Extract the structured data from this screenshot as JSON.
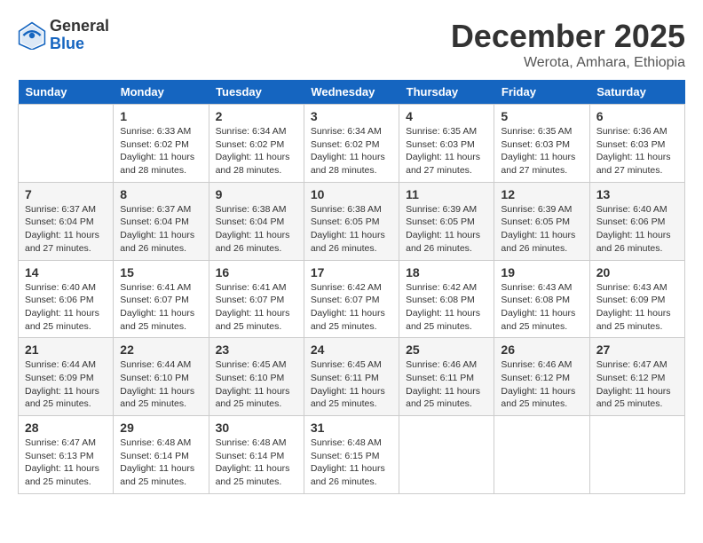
{
  "header": {
    "logo_general": "General",
    "logo_blue": "Blue",
    "month_title": "December 2025",
    "subtitle": "Werota, Amhara, Ethiopia"
  },
  "weekdays": [
    "Sunday",
    "Monday",
    "Tuesday",
    "Wednesday",
    "Thursday",
    "Friday",
    "Saturday"
  ],
  "weeks": [
    [
      {
        "day": "",
        "sunrise": "",
        "sunset": "",
        "daylight": ""
      },
      {
        "day": "1",
        "sunrise": "Sunrise: 6:33 AM",
        "sunset": "Sunset: 6:02 PM",
        "daylight": "Daylight: 11 hours and 28 minutes."
      },
      {
        "day": "2",
        "sunrise": "Sunrise: 6:34 AM",
        "sunset": "Sunset: 6:02 PM",
        "daylight": "Daylight: 11 hours and 28 minutes."
      },
      {
        "day": "3",
        "sunrise": "Sunrise: 6:34 AM",
        "sunset": "Sunset: 6:02 PM",
        "daylight": "Daylight: 11 hours and 28 minutes."
      },
      {
        "day": "4",
        "sunrise": "Sunrise: 6:35 AM",
        "sunset": "Sunset: 6:03 PM",
        "daylight": "Daylight: 11 hours and 27 minutes."
      },
      {
        "day": "5",
        "sunrise": "Sunrise: 6:35 AM",
        "sunset": "Sunset: 6:03 PM",
        "daylight": "Daylight: 11 hours and 27 minutes."
      },
      {
        "day": "6",
        "sunrise": "Sunrise: 6:36 AM",
        "sunset": "Sunset: 6:03 PM",
        "daylight": "Daylight: 11 hours and 27 minutes."
      }
    ],
    [
      {
        "day": "7",
        "sunrise": "Sunrise: 6:37 AM",
        "sunset": "Sunset: 6:04 PM",
        "daylight": "Daylight: 11 hours and 27 minutes."
      },
      {
        "day": "8",
        "sunrise": "Sunrise: 6:37 AM",
        "sunset": "Sunset: 6:04 PM",
        "daylight": "Daylight: 11 hours and 26 minutes."
      },
      {
        "day": "9",
        "sunrise": "Sunrise: 6:38 AM",
        "sunset": "Sunset: 6:04 PM",
        "daylight": "Daylight: 11 hours and 26 minutes."
      },
      {
        "day": "10",
        "sunrise": "Sunrise: 6:38 AM",
        "sunset": "Sunset: 6:05 PM",
        "daylight": "Daylight: 11 hours and 26 minutes."
      },
      {
        "day": "11",
        "sunrise": "Sunrise: 6:39 AM",
        "sunset": "Sunset: 6:05 PM",
        "daylight": "Daylight: 11 hours and 26 minutes."
      },
      {
        "day": "12",
        "sunrise": "Sunrise: 6:39 AM",
        "sunset": "Sunset: 6:05 PM",
        "daylight": "Daylight: 11 hours and 26 minutes."
      },
      {
        "day": "13",
        "sunrise": "Sunrise: 6:40 AM",
        "sunset": "Sunset: 6:06 PM",
        "daylight": "Daylight: 11 hours and 26 minutes."
      }
    ],
    [
      {
        "day": "14",
        "sunrise": "Sunrise: 6:40 AM",
        "sunset": "Sunset: 6:06 PM",
        "daylight": "Daylight: 11 hours and 25 minutes."
      },
      {
        "day": "15",
        "sunrise": "Sunrise: 6:41 AM",
        "sunset": "Sunset: 6:07 PM",
        "daylight": "Daylight: 11 hours and 25 minutes."
      },
      {
        "day": "16",
        "sunrise": "Sunrise: 6:41 AM",
        "sunset": "Sunset: 6:07 PM",
        "daylight": "Daylight: 11 hours and 25 minutes."
      },
      {
        "day": "17",
        "sunrise": "Sunrise: 6:42 AM",
        "sunset": "Sunset: 6:07 PM",
        "daylight": "Daylight: 11 hours and 25 minutes."
      },
      {
        "day": "18",
        "sunrise": "Sunrise: 6:42 AM",
        "sunset": "Sunset: 6:08 PM",
        "daylight": "Daylight: 11 hours and 25 minutes."
      },
      {
        "day": "19",
        "sunrise": "Sunrise: 6:43 AM",
        "sunset": "Sunset: 6:08 PM",
        "daylight": "Daylight: 11 hours and 25 minutes."
      },
      {
        "day": "20",
        "sunrise": "Sunrise: 6:43 AM",
        "sunset": "Sunset: 6:09 PM",
        "daylight": "Daylight: 11 hours and 25 minutes."
      }
    ],
    [
      {
        "day": "21",
        "sunrise": "Sunrise: 6:44 AM",
        "sunset": "Sunset: 6:09 PM",
        "daylight": "Daylight: 11 hours and 25 minutes."
      },
      {
        "day": "22",
        "sunrise": "Sunrise: 6:44 AM",
        "sunset": "Sunset: 6:10 PM",
        "daylight": "Daylight: 11 hours and 25 minutes."
      },
      {
        "day": "23",
        "sunrise": "Sunrise: 6:45 AM",
        "sunset": "Sunset: 6:10 PM",
        "daylight": "Daylight: 11 hours and 25 minutes."
      },
      {
        "day": "24",
        "sunrise": "Sunrise: 6:45 AM",
        "sunset": "Sunset: 6:11 PM",
        "daylight": "Daylight: 11 hours and 25 minutes."
      },
      {
        "day": "25",
        "sunrise": "Sunrise: 6:46 AM",
        "sunset": "Sunset: 6:11 PM",
        "daylight": "Daylight: 11 hours and 25 minutes."
      },
      {
        "day": "26",
        "sunrise": "Sunrise: 6:46 AM",
        "sunset": "Sunset: 6:12 PM",
        "daylight": "Daylight: 11 hours and 25 minutes."
      },
      {
        "day": "27",
        "sunrise": "Sunrise: 6:47 AM",
        "sunset": "Sunset: 6:12 PM",
        "daylight": "Daylight: 11 hours and 25 minutes."
      }
    ],
    [
      {
        "day": "28",
        "sunrise": "Sunrise: 6:47 AM",
        "sunset": "Sunset: 6:13 PM",
        "daylight": "Daylight: 11 hours and 25 minutes."
      },
      {
        "day": "29",
        "sunrise": "Sunrise: 6:48 AM",
        "sunset": "Sunset: 6:14 PM",
        "daylight": "Daylight: 11 hours and 25 minutes."
      },
      {
        "day": "30",
        "sunrise": "Sunrise: 6:48 AM",
        "sunset": "Sunset: 6:14 PM",
        "daylight": "Daylight: 11 hours and 25 minutes."
      },
      {
        "day": "31",
        "sunrise": "Sunrise: 6:48 AM",
        "sunset": "Sunset: 6:15 PM",
        "daylight": "Daylight: 11 hours and 26 minutes."
      },
      {
        "day": "",
        "sunrise": "",
        "sunset": "",
        "daylight": ""
      },
      {
        "day": "",
        "sunrise": "",
        "sunset": "",
        "daylight": ""
      },
      {
        "day": "",
        "sunrise": "",
        "sunset": "",
        "daylight": ""
      }
    ]
  ]
}
